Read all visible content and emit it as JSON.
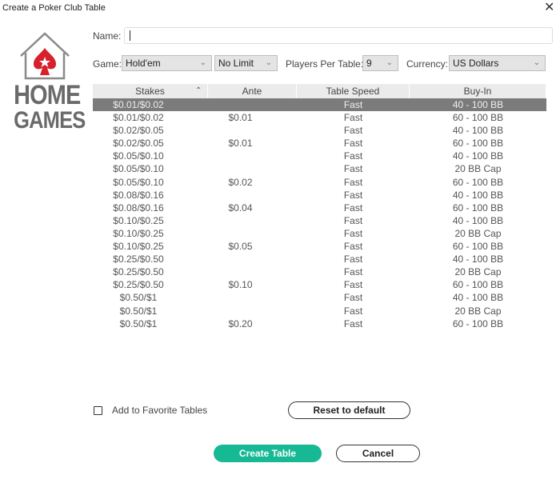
{
  "window": {
    "title": "Create a Poker Club Table",
    "close_icon": "close-icon"
  },
  "logo": {
    "line1": "HOME",
    "line2": "GAMES",
    "icon": "house-spade-icon",
    "accent_color": "#d6202b"
  },
  "form": {
    "name_label": "Name:",
    "name_value": "",
    "game_label": "Game:",
    "game_value": "Hold'em",
    "limit_value": "No Limit",
    "players_label": "Players Per Table:",
    "players_value": "9",
    "currency_label": "Currency:",
    "currency_value": "US Dollars"
  },
  "grid": {
    "columns": [
      "Stakes",
      "Ante",
      "Table Speed",
      "Buy-In"
    ],
    "sort_column": "Stakes",
    "sort_direction": "ascending",
    "selected_row": 0,
    "rows": [
      {
        "stakes": "$0.01/$0.02",
        "ante": "",
        "speed": "Fast",
        "buyin": "40 - 100 BB"
      },
      {
        "stakes": "$0.01/$0.02",
        "ante": "$0.01",
        "speed": "Fast",
        "buyin": "60 - 100 BB"
      },
      {
        "stakes": "$0.02/$0.05",
        "ante": "",
        "speed": "Fast",
        "buyin": "40 - 100 BB"
      },
      {
        "stakes": "$0.02/$0.05",
        "ante": "$0.01",
        "speed": "Fast",
        "buyin": "60 - 100 BB"
      },
      {
        "stakes": "$0.05/$0.10",
        "ante": "",
        "speed": "Fast",
        "buyin": "40 - 100 BB"
      },
      {
        "stakes": "$0.05/$0.10",
        "ante": "",
        "speed": "Fast",
        "buyin": "20 BB Cap"
      },
      {
        "stakes": "$0.05/$0.10",
        "ante": "$0.02",
        "speed": "Fast",
        "buyin": "60 - 100 BB"
      },
      {
        "stakes": "$0.08/$0.16",
        "ante": "",
        "speed": "Fast",
        "buyin": "40 - 100 BB"
      },
      {
        "stakes": "$0.08/$0.16",
        "ante": "$0.04",
        "speed": "Fast",
        "buyin": "60 - 100 BB"
      },
      {
        "stakes": "$0.10/$0.25",
        "ante": "",
        "speed": "Fast",
        "buyin": "40 - 100 BB"
      },
      {
        "stakes": "$0.10/$0.25",
        "ante": "",
        "speed": "Fast",
        "buyin": "20 BB Cap"
      },
      {
        "stakes": "$0.10/$0.25",
        "ante": "$0.05",
        "speed": "Fast",
        "buyin": "60 - 100 BB"
      },
      {
        "stakes": "$0.25/$0.50",
        "ante": "",
        "speed": "Fast",
        "buyin": "40 - 100 BB"
      },
      {
        "stakes": "$0.25/$0.50",
        "ante": "",
        "speed": "Fast",
        "buyin": "20 BB Cap"
      },
      {
        "stakes": "$0.25/$0.50",
        "ante": "$0.10",
        "speed": "Fast",
        "buyin": "60 - 100 BB"
      },
      {
        "stakes": "$0.50/$1",
        "ante": "",
        "speed": "Fast",
        "buyin": "40 - 100 BB"
      },
      {
        "stakes": "$0.50/$1",
        "ante": "",
        "speed": "Fast",
        "buyin": "20 BB Cap"
      },
      {
        "stakes": "$0.50/$1",
        "ante": "$0.20",
        "speed": "Fast",
        "buyin": "60 - 100 BB"
      }
    ]
  },
  "footer": {
    "favorite_label": "Add to Favorite Tables",
    "favorite_checked": false,
    "reset_label": "Reset to default",
    "create_label": "Create Table",
    "cancel_label": "Cancel",
    "primary_color": "#17b894"
  }
}
